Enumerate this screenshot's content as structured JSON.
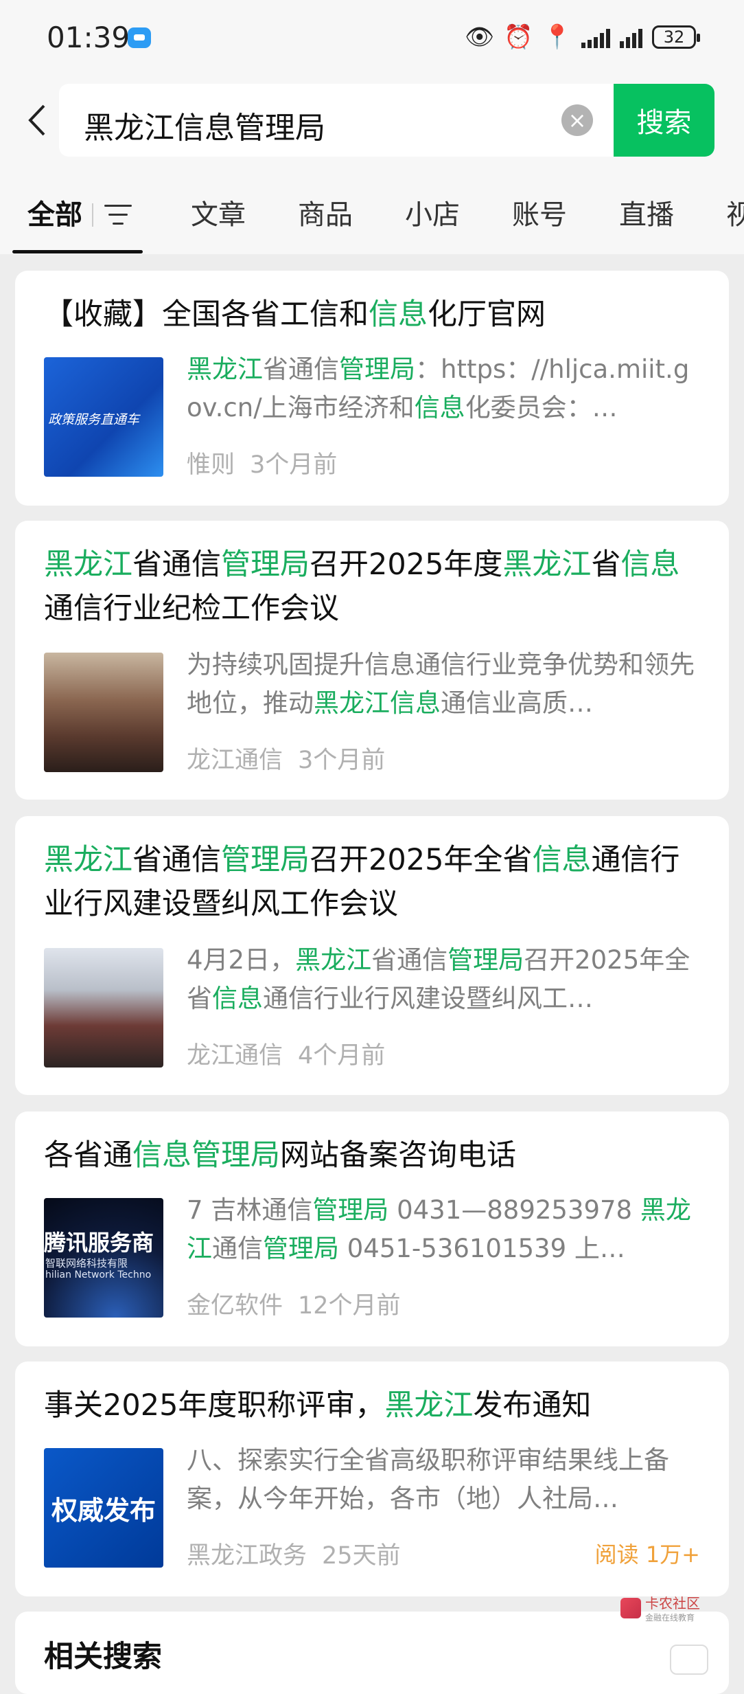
{
  "status_bar": {
    "time": "01:39",
    "battery": "32"
  },
  "search": {
    "query": "黑龙江信息管理局",
    "button_label": "搜索"
  },
  "tabs": [
    "全部",
    "文章",
    "商品",
    "小店",
    "账号",
    "直播",
    "视"
  ],
  "colors": {
    "accent": "#07c160",
    "highlight": "#1aad5e",
    "read_badge": "#f0a13a"
  },
  "results": [
    {
      "title": [
        "【收藏】全国各省工信和",
        "信息",
        "化厅官网"
      ],
      "snippet": [
        "黑龙江",
        "省通信",
        "管理局",
        "：https：//hljca.miit.gov.cn/上海市经济和",
        "信息",
        "化委员会：…"
      ],
      "source": "惟则",
      "time": "3个月前",
      "thumb_text": "政策服务直通车"
    },
    {
      "title": [
        "黑龙江",
        "省通信",
        "管理局",
        "召开2025年度",
        "黑龙江",
        "省",
        "信息",
        "通信行业纪检工作会议"
      ],
      "snippet": [
        "为持续巩固提升信息通信行业竞争优势和领先地位，推动",
        "黑龙江信息",
        "通信业高质…"
      ],
      "source": "龙江通信",
      "time": "3个月前"
    },
    {
      "title": [
        "黑龙江",
        "省通信",
        "管理局",
        "召开2025年全省",
        "信息",
        "通信行业行风建设暨纠风工作会议"
      ],
      "snippet": [
        "4月2日，",
        "黑龙江",
        "省通信",
        "管理局",
        "召开2025年全省",
        "信息",
        "通信行业行风建设暨纠风工…"
      ],
      "source": "龙江通信",
      "time": "4个月前"
    },
    {
      "title": [
        "各省通",
        "信息管理局",
        "网站备案咨询电话"
      ],
      "snippet": [
        "7 吉林通信",
        "管理局",
        " 0431—889253978 ",
        "黑龙江",
        "通信",
        "管理局",
        " 0451-536101539 上…"
      ],
      "source": "金亿软件",
      "time": "12个月前",
      "thumb_text": "腾讯服务商",
      "thumb_sub": "智联网络科技有限",
      "thumb_en": "hilian Network Techno"
    },
    {
      "title": [
        "事关2025年度职称评审，",
        "黑龙江",
        "发布通知"
      ],
      "snippet": [
        "八、探索实行全省高级职称评审结果线上备案，从今年开始，各市（地）人社局…"
      ],
      "source": "黑龙江政务",
      "time": "25天前",
      "read": "阅读 1万+",
      "thumb_text": "权威发布"
    }
  ],
  "related_title": "相关搜索",
  "watermark": {
    "text": "卡农社区",
    "sub": "金融在线教育"
  }
}
